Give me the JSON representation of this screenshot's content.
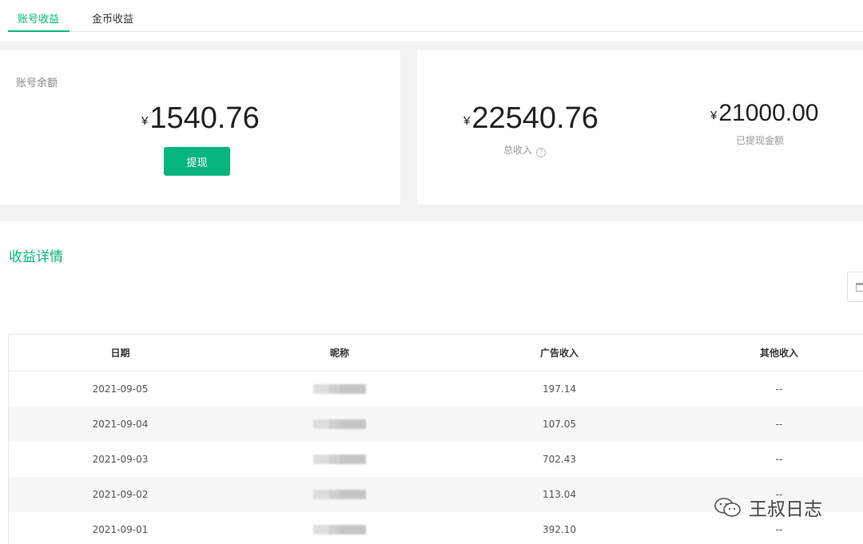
{
  "tabs": [
    {
      "label": "账号收益",
      "active": true
    },
    {
      "label": "金币收益",
      "active": false
    }
  ],
  "balance": {
    "label": "账号余额",
    "currency": "¥",
    "amount": "1540.76",
    "withdraw_label": "提现"
  },
  "income": {
    "total_currency": "¥",
    "total_amount": "22540.76",
    "total_label": "总收入",
    "help_glyph": "?",
    "withdrawn_currency": "¥",
    "withdrawn_amount": "21000.00",
    "withdrawn_label": "已提现金额"
  },
  "detail": {
    "title": "收益详情",
    "columns": [
      "日期",
      "昵称",
      "广告收入",
      "其他收入"
    ],
    "rows": [
      {
        "date": "2021-09-05",
        "ad": "197.14",
        "other": "--"
      },
      {
        "date": "2021-09-04",
        "ad": "107.05",
        "other": "--"
      },
      {
        "date": "2021-09-03",
        "ad": "702.43",
        "other": "--"
      },
      {
        "date": "2021-09-02",
        "ad": "113.04",
        "other": "--"
      },
      {
        "date": "2021-09-01",
        "ad": "392.10",
        "other": "--"
      }
    ]
  },
  "watermark": {
    "text": "王叔日志",
    "icon": "wechat-icon"
  },
  "colors": {
    "accent": "#07b57d"
  }
}
